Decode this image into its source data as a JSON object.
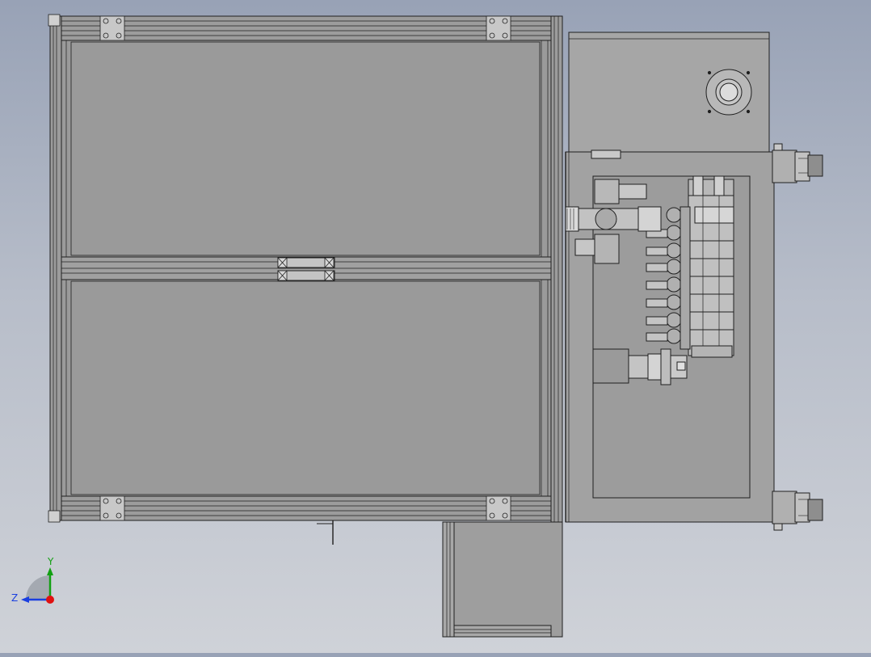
{
  "app": {
    "kind": "CAD assembly viewport"
  },
  "triad": {
    "axis_y": "Y",
    "axis_z": "Z"
  },
  "colors": {
    "background_top": "#98a2b6",
    "background_bottom": "#cfd2d8",
    "part_gray": "#9a9a9a",
    "light_gray": "#b4b4b4",
    "edge_dark": "#1f1f1f",
    "axis_y": "#12a012",
    "axis_z": "#1a3fe0",
    "axis_x": "#e01010"
  },
  "icons": [
    "view-triad-icon"
  ]
}
